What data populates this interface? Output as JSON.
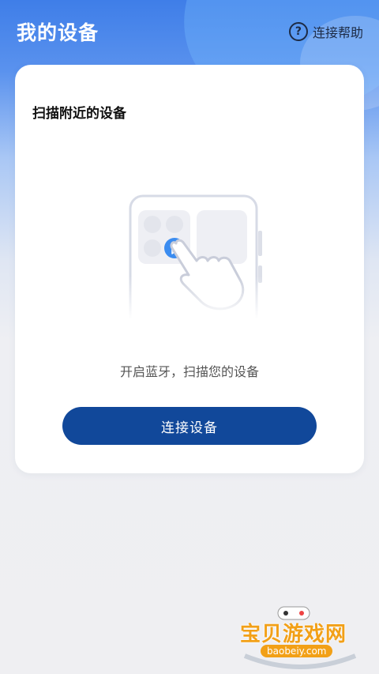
{
  "header": {
    "title": "我的设备",
    "help_label": "连接帮助",
    "help_icon_glyph": "?"
  },
  "card": {
    "title": "扫描附近的设备",
    "hint": "开启蓝牙，扫描您的设备",
    "button_label": "连接设备"
  },
  "watermark": {
    "text": "宝贝游戏网",
    "url": "baobeiy.com"
  },
  "colors": {
    "header_blue": "#3f7ee8",
    "button_blue": "#11489a",
    "bluetooth_blue": "#3b8cf0",
    "watermark_orange": "#f2a017"
  }
}
